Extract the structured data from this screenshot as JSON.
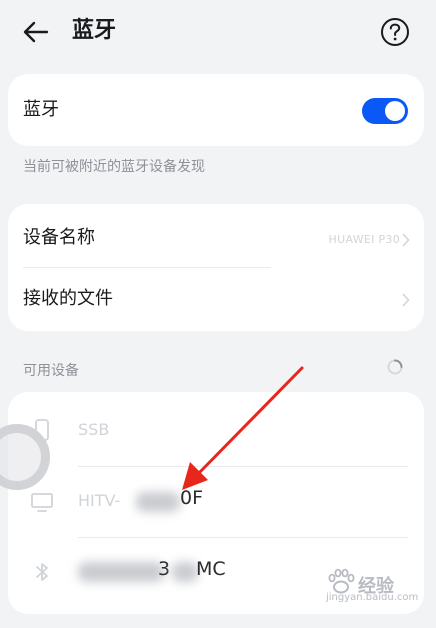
{
  "header": {
    "title": "蓝牙"
  },
  "bluetooth_card": {
    "label": "蓝牙",
    "enabled": true,
    "accent_color": "#0a59f7"
  },
  "visibility_note": "当前可被附近的蓝牙设备发现",
  "settings_card": {
    "device_name_label": "设备名称",
    "device_name_value": "HUAWEI P30",
    "received_files_label": "接收的文件"
  },
  "available_devices": {
    "header": "可用设备",
    "items": [
      {
        "name": "SSB",
        "icon": "phone-icon"
      },
      {
        "name": "HITV-F",
        "name_prefix": "HITV-",
        "name_suffix": "0F",
        "icon": "tv-icon"
      },
      {
        "name": "3MC",
        "name_mid": "3",
        "name_suffix": "MC",
        "icon": "bluetooth-icon"
      }
    ]
  },
  "watermark": {
    "brand": "经验",
    "url": "jingyan.baidu.com"
  }
}
